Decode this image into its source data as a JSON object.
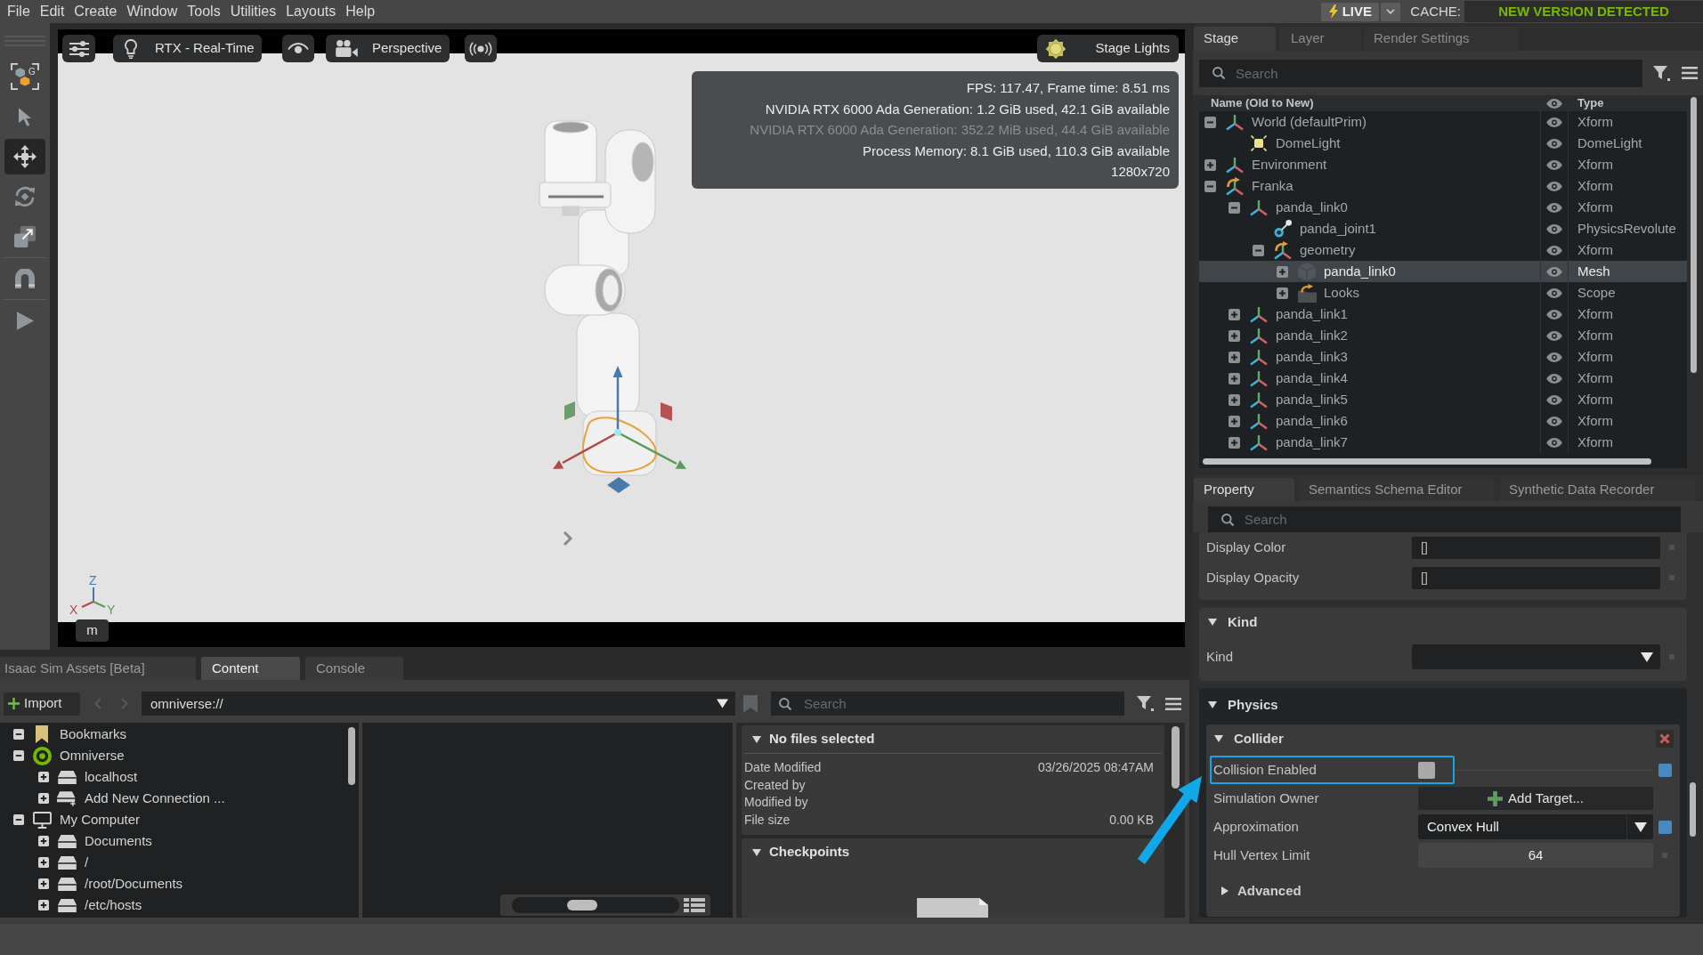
{
  "menu_bar": {
    "menus": [
      "File",
      "Edit",
      "Create",
      "Window",
      "Tools",
      "Utilities",
      "Layouts",
      "Help"
    ],
    "live_button": "LIVE",
    "cache_label": "CACHE:",
    "cache_status": "NEW VERSION DETECTED"
  },
  "tools": [
    {
      "kind": "selection_mode",
      "selected": false,
      "letter": "G"
    },
    {
      "kind": "select",
      "selected": false
    },
    {
      "kind": "move",
      "selected": true
    },
    {
      "kind": "rotate",
      "selected": false
    },
    {
      "kind": "scale",
      "selected": false
    },
    {
      "kind": "snap",
      "selected": false
    },
    {
      "kind": "play",
      "selected": false
    }
  ],
  "viewport": {
    "renderer": "RTX - Real-Time",
    "camera": "Perspective",
    "lights_button": "Stage Lights",
    "stats": [
      {
        "text": "FPS: 117.47, Frame time: 8.51 ms",
        "dimmed": false
      },
      {
        "text": "NVIDIA RTX 6000 Ada Generation: 1.2 GiB used, 42.1 GiB available",
        "dimmed": false
      },
      {
        "text": "NVIDIA RTX 6000 Ada Generation: 352.2 MiB used, 44.4 GiB available",
        "dimmed": true
      },
      {
        "text": "Process Memory: 8.1 GiB used, 110.3 GiB available",
        "dimmed": false
      },
      {
        "text": "1280x720",
        "dimmed": false
      }
    ],
    "axes": [
      {
        "kind": "z",
        "label": "Z",
        "color": "#4a78a8"
      },
      {
        "kind": "x",
        "label": "X",
        "color": "#b04a4a"
      },
      {
        "kind": "y",
        "label": "Y",
        "color": "#5a9a5a"
      }
    ],
    "units": "m"
  },
  "stage_panel": {
    "tabs": [
      {
        "label": "Stage",
        "selected": true
      },
      {
        "label": "Layer",
        "selected": false
      },
      {
        "label": "Render Settings",
        "selected": false
      }
    ],
    "search": {
      "placeholder": "Search"
    },
    "columns": [
      "Name (Old to New)",
      "Type"
    ],
    "tree": [
      {
        "name": "World (defaultPrim)",
        "type": "Xform",
        "kind": "xform",
        "expanded": true,
        "selected": false,
        "children": [
          {
            "name": "DomeLight",
            "type": "DomeLight",
            "kind": "light",
            "selected": false
          }
        ]
      },
      {
        "name": "Environment",
        "type": "Xform",
        "kind": "xform",
        "expanded": false,
        "selected": false
      },
      {
        "name": "Franka",
        "type": "Xform",
        "kind": "reference",
        "expanded": true,
        "selected": false,
        "children": [
          {
            "name": "panda_link0",
            "type": "Xform",
            "kind": "xform",
            "expanded": true,
            "selected": false,
            "children": [
              {
                "name": "panda_joint1",
                "type": "PhysicsRevolute",
                "kind": "joint",
                "selected": false
              },
              {
                "name": "geometry",
                "type": "Xform",
                "kind": "reference",
                "expanded": true,
                "selected": false,
                "children": [
                  {
                    "name": "panda_link0",
                    "type": "Mesh",
                    "kind": "mesh",
                    "expanded": false,
                    "selected": true
                  },
                  {
                    "name": "Looks",
                    "type": "Scope",
                    "kind": "scope",
                    "expanded": false,
                    "selected": false
                  }
                ]
              }
            ]
          },
          {
            "name": "panda_link1",
            "type": "Xform",
            "kind": "xform",
            "expanded": false,
            "selected": false
          },
          {
            "name": "panda_link2",
            "type": "Xform",
            "kind": "xform",
            "expanded": false,
            "selected": false
          },
          {
            "name": "panda_link3",
            "type": "Xform",
            "kind": "xform",
            "expanded": false,
            "selected": false
          },
          {
            "name": "panda_link4",
            "type": "Xform",
            "kind": "xform",
            "expanded": false,
            "selected": false
          },
          {
            "name": "panda_link5",
            "type": "Xform",
            "kind": "xform",
            "expanded": false,
            "selected": false
          },
          {
            "name": "panda_link6",
            "type": "Xform",
            "kind": "xform",
            "expanded": false,
            "selected": false
          },
          {
            "name": "panda_link7",
            "type": "Xform",
            "kind": "xform",
            "expanded": false,
            "selected": false
          }
        ]
      }
    ]
  },
  "property_panel": {
    "tabs": [
      {
        "label": "Property",
        "selected": true
      },
      {
        "label": "Semantics Schema Editor",
        "selected": false
      },
      {
        "label": "Synthetic Data Recorder",
        "selected": false
      }
    ],
    "search": {
      "placeholder": "Search"
    },
    "rows": [
      {
        "kind": "field",
        "label": "Display Color",
        "value": "[]",
        "modified": false
      },
      {
        "kind": "field",
        "label": "Display Opacity",
        "value": "[]",
        "modified": false
      }
    ],
    "sections": [
      {
        "title": "Kind",
        "expanded": true,
        "rows": [
          {
            "kind": "dropdown",
            "label": "Kind",
            "modified": false
          }
        ]
      },
      {
        "title": "Physics",
        "expanded": true,
        "groups": [
          {
            "title": "Collider",
            "expanded": true,
            "rows": [
              {
                "kind": "checkbox",
                "label": "Collision Enabled",
                "checked": false,
                "highlighted": true,
                "modified": true
              },
              {
                "kind": "button",
                "label": "Simulation Owner",
                "button": "Add Target..."
              },
              {
                "kind": "dropdown",
                "label": "Approximation",
                "value": "Convex Hull",
                "modified": true
              },
              {
                "kind": "number",
                "label": "Hull Vertex Limit",
                "value": "64",
                "modified": false
              }
            ],
            "subgroups": [
              {
                "title": "Advanced",
                "expanded": false
              }
            ]
          }
        ]
      }
    ]
  },
  "content_panel": {
    "tabs": [
      {
        "label": "Isaac Sim Assets [Beta]",
        "selected": false
      },
      {
        "label": "Content",
        "selected": true
      },
      {
        "label": "Console",
        "selected": false
      }
    ],
    "import_button": "Import",
    "back_button": {
      "disabled": true
    },
    "forward_button": {
      "disabled": true
    },
    "path": "omniverse://",
    "search": {
      "placeholder": "Search"
    },
    "tree": [
      {
        "name": "Bookmarks",
        "kind": "bookmark",
        "expanded": true
      },
      {
        "name": "Omniverse",
        "kind": "omniverse",
        "expanded": true,
        "children": [
          {
            "name": "localhost",
            "kind": "server",
            "expanded": false
          },
          {
            "name": "Add New Connection ...",
            "kind": "add_server",
            "expanded": false
          }
        ]
      },
      {
        "name": "My Computer",
        "kind": "computer",
        "expanded": true,
        "children": [
          {
            "name": "Documents",
            "kind": "drive",
            "expanded": false
          },
          {
            "name": "/",
            "kind": "drive",
            "expanded": false
          },
          {
            "name": "/root/Documents",
            "kind": "drive",
            "expanded": false
          },
          {
            "name": "/etc/hosts",
            "kind": "drive",
            "expanded": false
          }
        ]
      }
    ],
    "thumbnail_size": {
      "level": 0.4
    },
    "details": {
      "title": "No files selected",
      "expanded": true,
      "fields": [
        {
          "label": "Date Modified",
          "value": "03/26/2025 08:47AM"
        },
        {
          "label": "Created by"
        },
        {
          "label": "Modified by"
        },
        {
          "label": "File size",
          "value": "0.00 KB"
        }
      ]
    },
    "checkpoints": {
      "title": "Checkpoints",
      "expanded": true
    }
  }
}
